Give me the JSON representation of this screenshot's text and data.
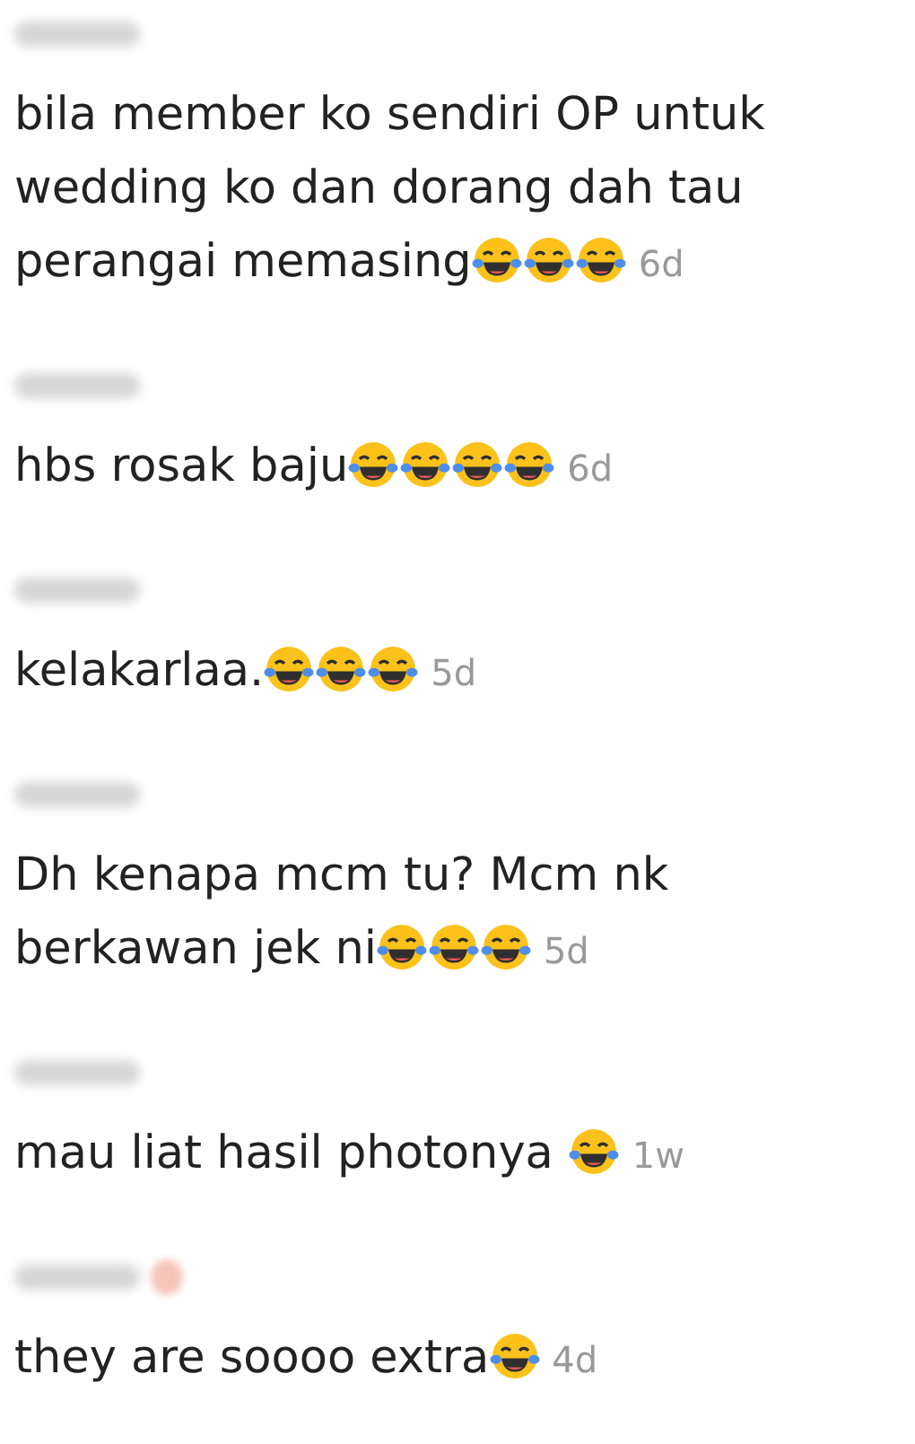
{
  "comments": [
    {
      "username_badge": false,
      "text": "bila member ko sendiri OP untuk wedding ko dan dorang dah tau perangai memasing",
      "emojis": [
        {
          "kind": "laugh"
        },
        {
          "kind": "laugh"
        },
        {
          "kind": "laugh"
        }
      ],
      "emoji_gap": false,
      "time": "6d"
    },
    {
      "username_badge": false,
      "text": "hbs rosak baju",
      "emojis": [
        {
          "kind": "laugh"
        },
        {
          "kind": "laugh"
        },
        {
          "kind": "laugh"
        },
        {
          "kind": "laugh"
        }
      ],
      "emoji_gap": false,
      "time": "6d"
    },
    {
      "username_badge": false,
      "text": "kelakarlaa.",
      "emojis": [
        {
          "kind": "laugh"
        },
        {
          "kind": "laugh"
        },
        {
          "kind": "laugh"
        }
      ],
      "emoji_gap": false,
      "time": "5d"
    },
    {
      "username_badge": false,
      "text": "Dh kenapa mcm tu? Mcm nk berkawan jek ni",
      "emojis": [
        {
          "kind": "laugh"
        },
        {
          "kind": "laugh"
        },
        {
          "kind": "laugh"
        }
      ],
      "emoji_gap": false,
      "time": "5d"
    },
    {
      "username_badge": false,
      "text": "mau liat hasil photonya",
      "emojis": [
        {
          "kind": "laugh"
        }
      ],
      "emoji_gap": true,
      "time": "1w"
    },
    {
      "username_badge": true,
      "text": "they are soooo extra",
      "emojis": [
        {
          "kind": "laugh"
        }
      ],
      "emoji_gap": false,
      "time": "4d"
    }
  ]
}
